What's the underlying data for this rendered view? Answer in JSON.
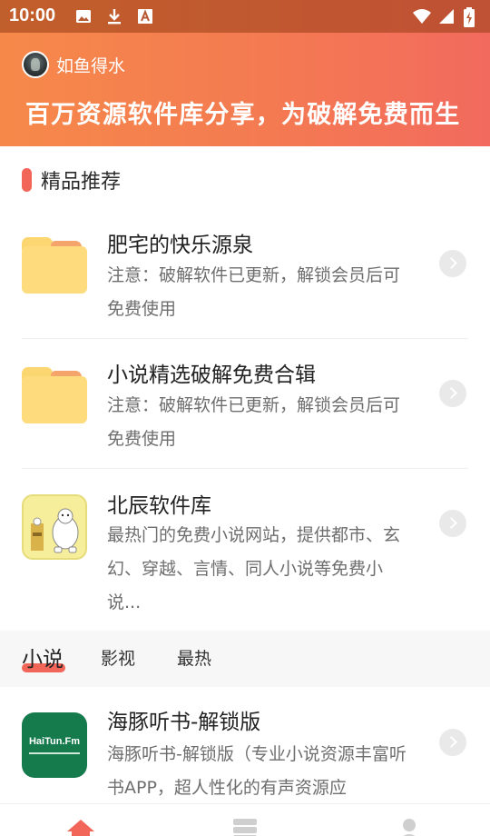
{
  "status_bar": {
    "time": "10:00",
    "left_icons": [
      "image-icon",
      "download-icon",
      "font-icon"
    ],
    "right_icons": [
      "wifi-icon",
      "signal-icon",
      "battery-charging-icon"
    ]
  },
  "header": {
    "username": "如鱼得水",
    "slogan": "百万资源软件库分享，为破解免费而生",
    "gradient_start": "#f6894a",
    "gradient_end": "#f26a5e"
  },
  "section": {
    "title": "精品推荐",
    "accent": "#f26659"
  },
  "featured": [
    {
      "title": "肥宅的快乐源泉",
      "desc": "注意：破解软件已更新，解锁会员后可免费使用",
      "icon": "folder-icon"
    },
    {
      "title": "小说精选破解免费合辑",
      "desc": "注意：破解软件已更新，解锁会员后可免费使用",
      "icon": "folder-icon"
    },
    {
      "title": "北辰软件库",
      "desc": "最热门的免费小说网站，提供都市、玄幻、穿越、言情、同人小说等免费小说...",
      "icon": "beichen-app-icon"
    }
  ],
  "tabs": [
    {
      "label": "小说",
      "active": true
    },
    {
      "label": "影视",
      "active": false
    },
    {
      "label": "最热",
      "active": false
    }
  ],
  "list": [
    {
      "title": "海豚听书-解锁版",
      "desc": "海豚听书-解锁版（专业小说资源丰富听书APP，超人性化的有声资源应",
      "icon_text": "HaiTun.Fm",
      "icon": "haitun-app-icon"
    }
  ],
  "bottom_nav": [
    {
      "icon": "home-icon",
      "active": true
    },
    {
      "icon": "library-icon",
      "active": false
    },
    {
      "icon": "profile-icon",
      "active": false
    }
  ]
}
